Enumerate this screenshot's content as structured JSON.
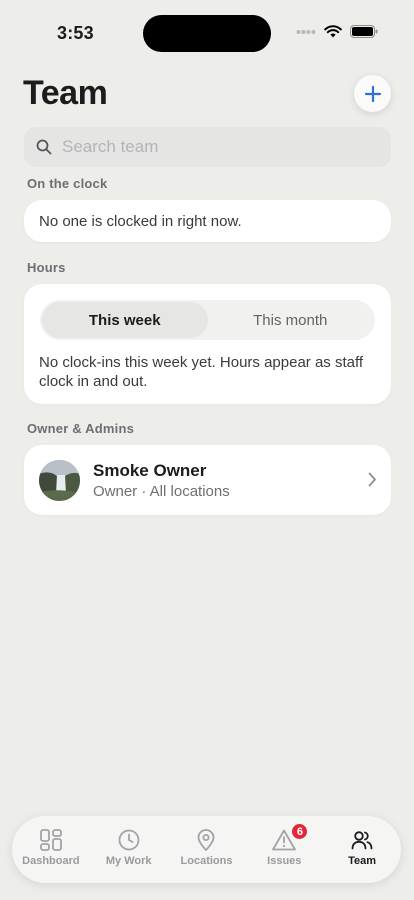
{
  "status_bar": {
    "time": "3:53"
  },
  "header": {
    "title": "Team"
  },
  "search": {
    "placeholder": "Search team",
    "value": ""
  },
  "sections": {
    "on_the_clock": {
      "label": "On the clock",
      "empty_text": "No one is clocked in right now."
    },
    "hours": {
      "label": "Hours",
      "tabs": [
        "This week",
        "This month"
      ],
      "selected_tab": "This week",
      "empty_text": "No clock-ins this week yet. Hours appear as staff clock in and out."
    },
    "owners": {
      "label": "Owner & Admins",
      "members": [
        {
          "name": "Smoke Owner",
          "role": "Owner · All locations"
        }
      ]
    }
  },
  "tab_bar": {
    "items": [
      {
        "label": "Dashboard",
        "icon": "dashboard-icon",
        "active": false
      },
      {
        "label": "My Work",
        "icon": "clock-icon",
        "active": false
      },
      {
        "label": "Locations",
        "icon": "location-pin-icon",
        "active": false
      },
      {
        "label": "Issues",
        "icon": "warning-icon",
        "active": false,
        "badge": "6"
      },
      {
        "label": "Team",
        "icon": "people-icon",
        "active": true
      }
    ]
  },
  "colors": {
    "accent": "#2f6fd6",
    "badge": "#e0283a",
    "background": "#ededea"
  }
}
